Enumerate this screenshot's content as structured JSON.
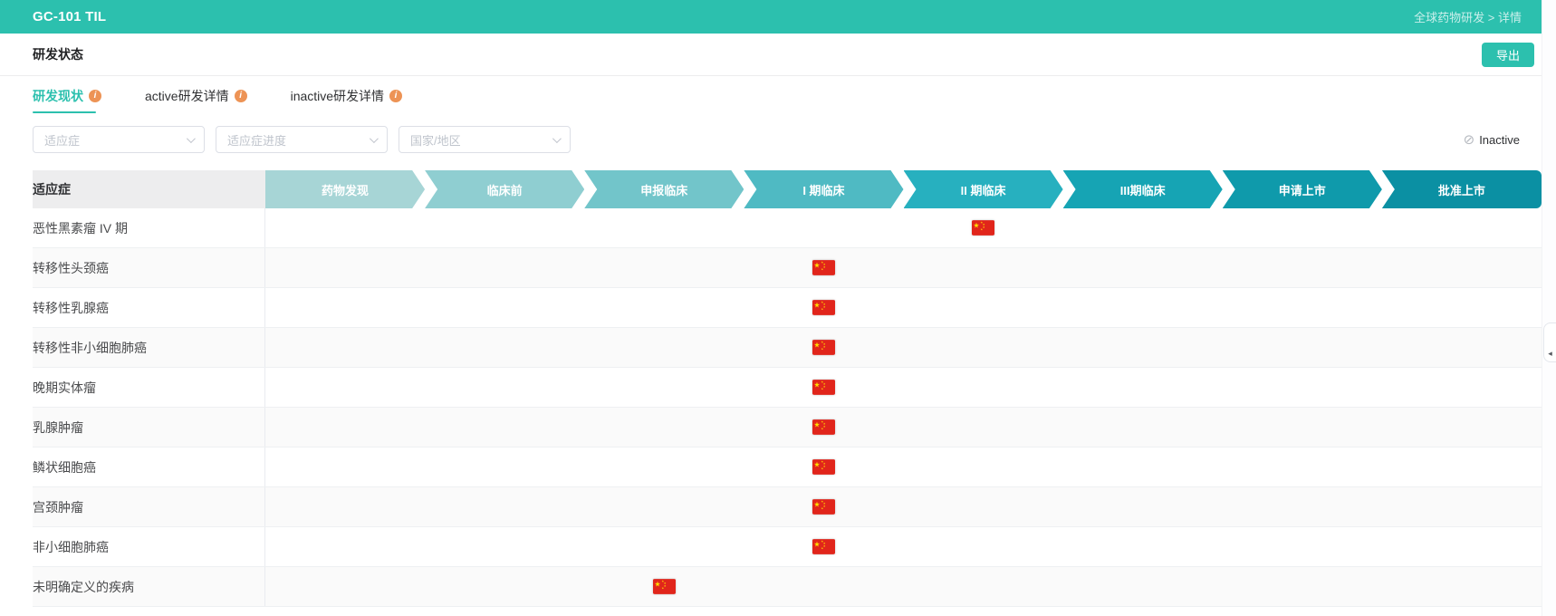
{
  "app": {
    "title": "GC-101 TIL",
    "breadcrumb": "全球药物研发 > 详情"
  },
  "page": {
    "heading": "研发状态",
    "export_label": "导出"
  },
  "tabs": [
    {
      "label": "研发现状",
      "active": true,
      "icon": "info-icon"
    },
    {
      "label": "active研发详情",
      "active": false,
      "icon": "info-icon"
    },
    {
      "label": "inactive研发详情",
      "active": false,
      "icon": "info-icon"
    }
  ],
  "filters": [
    {
      "placeholder": "适应症"
    },
    {
      "placeholder": "适应症进度"
    },
    {
      "placeholder": "国家/地区"
    }
  ],
  "inactive_toggle": {
    "label": "Inactive",
    "icon": "circle-slash-icon"
  },
  "table": {
    "first_col_header": "适应症",
    "stages": [
      {
        "label": "药物发现",
        "color": "#a7d5d6"
      },
      {
        "label": "临床前",
        "color": "#8fced1"
      },
      {
        "label": "申报临床",
        "color": "#72c5ca"
      },
      {
        "label": "I 期临床",
        "color": "#4fbac3"
      },
      {
        "label": "II 期临床",
        "color": "#27b0bf"
      },
      {
        "label": "III期临床",
        "color": "#16a4b4"
      },
      {
        "label": "申请上市",
        "color": "#0f9aab"
      },
      {
        "label": "批准上市",
        "color": "#0b90a3"
      }
    ],
    "rows": [
      {
        "indication": "恶性黑素瘤 IV 期",
        "stage": "II 期临床",
        "stage_index": 4,
        "marker": "china-flag"
      },
      {
        "indication": "转移性头颈癌",
        "stage": "I 期临床",
        "stage_index": 3,
        "marker": "china-flag"
      },
      {
        "indication": "转移性乳腺癌",
        "stage": "I 期临床",
        "stage_index": 3,
        "marker": "china-flag"
      },
      {
        "indication": "转移性非小细胞肺癌",
        "stage": "I 期临床",
        "stage_index": 3,
        "marker": "china-flag"
      },
      {
        "indication": "晚期实体瘤",
        "stage": "I 期临床",
        "stage_index": 3,
        "marker": "china-flag"
      },
      {
        "indication": "乳腺肿瘤",
        "stage": "I 期临床",
        "stage_index": 3,
        "marker": "china-flag"
      },
      {
        "indication": "鳞状细胞癌",
        "stage": "I 期临床",
        "stage_index": 3,
        "marker": "china-flag"
      },
      {
        "indication": "宫颈肿瘤",
        "stage": "I 期临床",
        "stage_index": 3,
        "marker": "china-flag"
      },
      {
        "indication": "非小细胞肺癌",
        "stage": "I 期临床",
        "stage_index": 3,
        "marker": "china-flag"
      },
      {
        "indication": "未明确定义的疾病",
        "stage": "申报临床",
        "stage_index": 2,
        "marker": "china-flag"
      }
    ]
  },
  "icons": {
    "info": "i",
    "circle_slash": "⊘",
    "collapse": "◂"
  },
  "colors": {
    "accent": "#2cc0ae",
    "flag_red": "#e1251b",
    "flag_yellow": "#ffde00",
    "info_icon": "#ed9355"
  }
}
